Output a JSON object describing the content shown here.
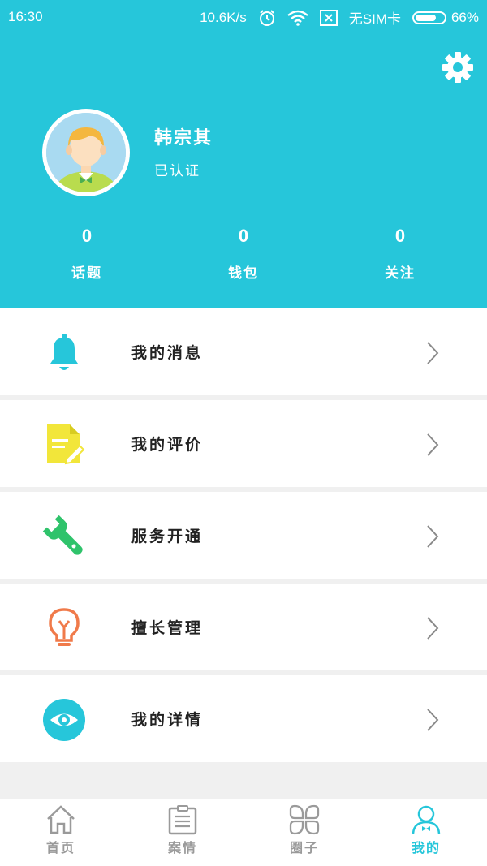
{
  "status_bar": {
    "time": "16:30",
    "speed": "10.6K/s",
    "sim": "无SIM卡",
    "battery": "66%",
    "battery_level": 0.66
  },
  "profile": {
    "name": "韩宗其",
    "status": "已认证",
    "settings_icon": "gear-icon",
    "stats": [
      {
        "value": "0",
        "label": "话题"
      },
      {
        "value": "0",
        "label": "钱包"
      },
      {
        "value": "0",
        "label": "关注"
      }
    ]
  },
  "menu": [
    {
      "label": "我的消息",
      "icon": "bell-icon",
      "color": "#26c6da"
    },
    {
      "label": "我的评价",
      "icon": "document-edit-icon",
      "color": "#f2e63a"
    },
    {
      "label": "服务开通",
      "icon": "wrench-icon",
      "color": "#2fc36b"
    },
    {
      "label": "擅长管理",
      "icon": "lightbulb-icon",
      "color": "#f07a4a"
    },
    {
      "label": "我的详情",
      "icon": "eye-icon",
      "color": "#26c6da"
    }
  ],
  "tabbar": {
    "active": "我的",
    "tabs": [
      {
        "label": "首页",
        "icon": "home-icon"
      },
      {
        "label": "案情",
        "icon": "clipboard-icon"
      },
      {
        "label": "圈子",
        "icon": "grid-icon"
      },
      {
        "label": "我的",
        "icon": "person-icon"
      }
    ]
  },
  "colors": {
    "accent": "#26c6da",
    "background": "#f0f0f0"
  }
}
